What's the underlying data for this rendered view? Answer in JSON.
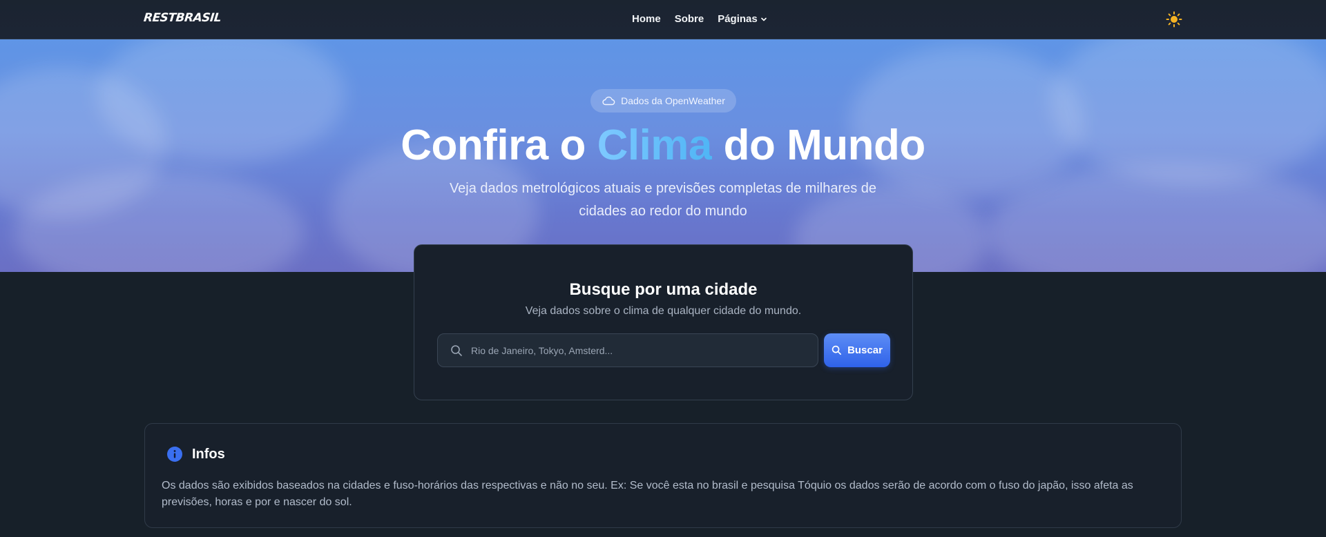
{
  "navbar": {
    "logo": "RESTBRASIL",
    "links": [
      {
        "label": "Home"
      },
      {
        "label": "Sobre"
      },
      {
        "label": "Páginas"
      }
    ],
    "theme_icon": "sun-icon",
    "theme_color": "#f5b324"
  },
  "hero": {
    "badge": "Dados da OpenWeather",
    "badge_icon": "cloud-icon",
    "title_before": "Confira o",
    "title_accent": "Clima",
    "title_after": "do Mundo",
    "subtitle": "Veja dados metrológicos atuais e previsões completas de milhares de cidades ao redor do mundo"
  },
  "search": {
    "title": "Busque por uma cidade",
    "subtitle": "Veja dados sobre o clima de qualquer cidade do mundo.",
    "placeholder": "Rio de Janeiro, Tokyo, Amsterd...",
    "value": "",
    "button_label": "Buscar",
    "accent_color": "#3b6ef0"
  },
  "info": {
    "title": "Infos",
    "icon": "info-icon",
    "text": "Os dados são exibidos baseados na cidades e fuso-horários das respectivas e não no seu. Ex: Se você esta no brasil e pesquisa Tóquio os dados serão de acordo com o fuso do japão, isso afeta as previsões, horas e por e nascer do sol."
  }
}
